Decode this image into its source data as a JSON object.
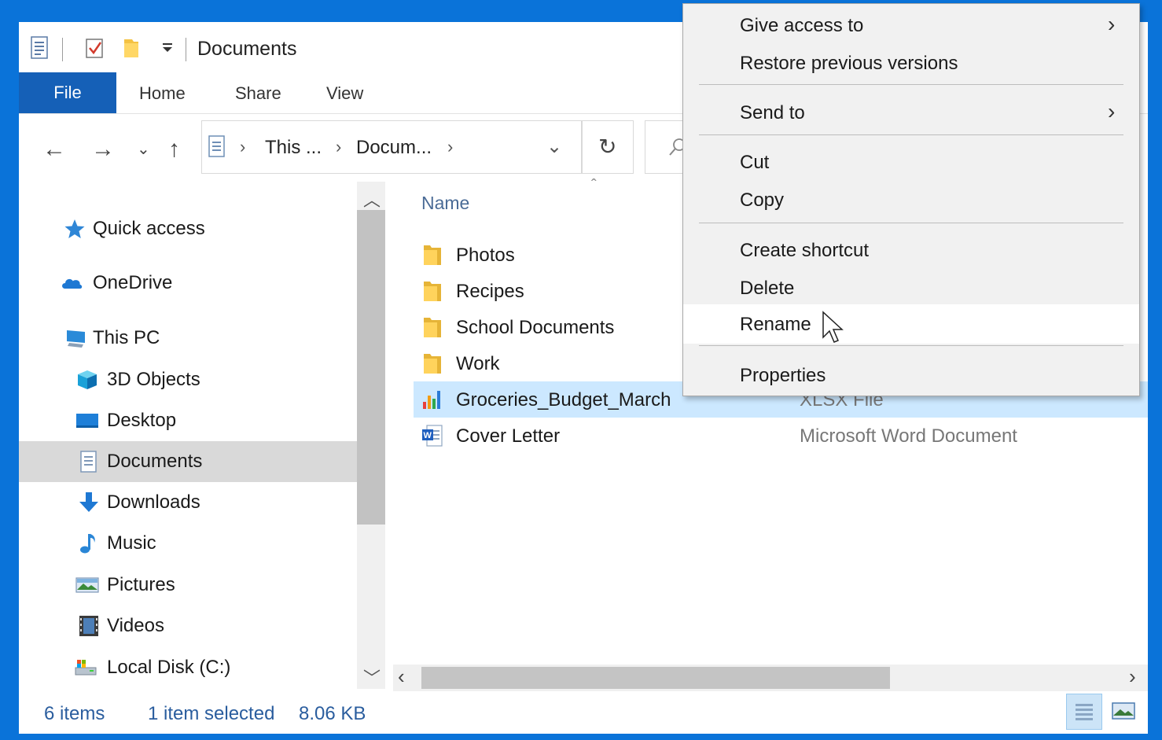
{
  "window": {
    "title": "Documents",
    "quick_access_toolbar": [
      "properties-icon",
      "checkmark-icon",
      "new-folder-icon",
      "customize-dropdown-icon"
    ]
  },
  "ribbon": {
    "tabs": [
      "File",
      "Home",
      "Share",
      "View"
    ],
    "active_tab": "File",
    "accent_color": "#1560b7"
  },
  "address": {
    "crumbs": [
      "This ...",
      "Docum..."
    ]
  },
  "nav_pane": {
    "items": [
      {
        "label": "Quick access",
        "icon": "star-icon"
      },
      {
        "label": "OneDrive",
        "icon": "cloud-icon"
      },
      {
        "label": "This PC",
        "icon": "computer-icon"
      },
      {
        "label": "3D Objects",
        "icon": "cube-icon"
      },
      {
        "label": "Desktop",
        "icon": "desktop-icon"
      },
      {
        "label": "Documents",
        "icon": "documents-icon",
        "selected": true
      },
      {
        "label": "Downloads",
        "icon": "download-arrow-icon"
      },
      {
        "label": "Music",
        "icon": "music-note-icon"
      },
      {
        "label": "Pictures",
        "icon": "pictures-icon"
      },
      {
        "label": "Videos",
        "icon": "film-icon"
      },
      {
        "label": "Local Disk (C:)",
        "icon": "disk-icon"
      }
    ]
  },
  "file_list": {
    "column_name": "Name",
    "rows": [
      {
        "name": "Photos",
        "icon": "folder-icon",
        "type": ""
      },
      {
        "name": "Recipes",
        "icon": "folder-icon",
        "type": ""
      },
      {
        "name": "School Documents",
        "icon": "folder-icon",
        "type": ""
      },
      {
        "name": "Work",
        "icon": "folder-icon",
        "type": ""
      },
      {
        "name": "Groceries_Budget_March",
        "icon": "excel-chart-icon",
        "type": "XLSX File",
        "selected": true
      },
      {
        "name": "Cover Letter",
        "icon": "word-document-icon",
        "type": "Microsoft Word Document"
      }
    ]
  },
  "status": {
    "item_count": "6 items",
    "selection": "1 item selected",
    "size": "8.06 KB"
  },
  "context_menu": {
    "give_access": "Give access to",
    "restore": "Restore previous versions",
    "send_to": "Send to",
    "cut": "Cut",
    "copy": "Copy",
    "create_shortcut": "Create shortcut",
    "delete": "Delete",
    "rename": "Rename",
    "properties": "Properties",
    "hovered": "Rename"
  }
}
